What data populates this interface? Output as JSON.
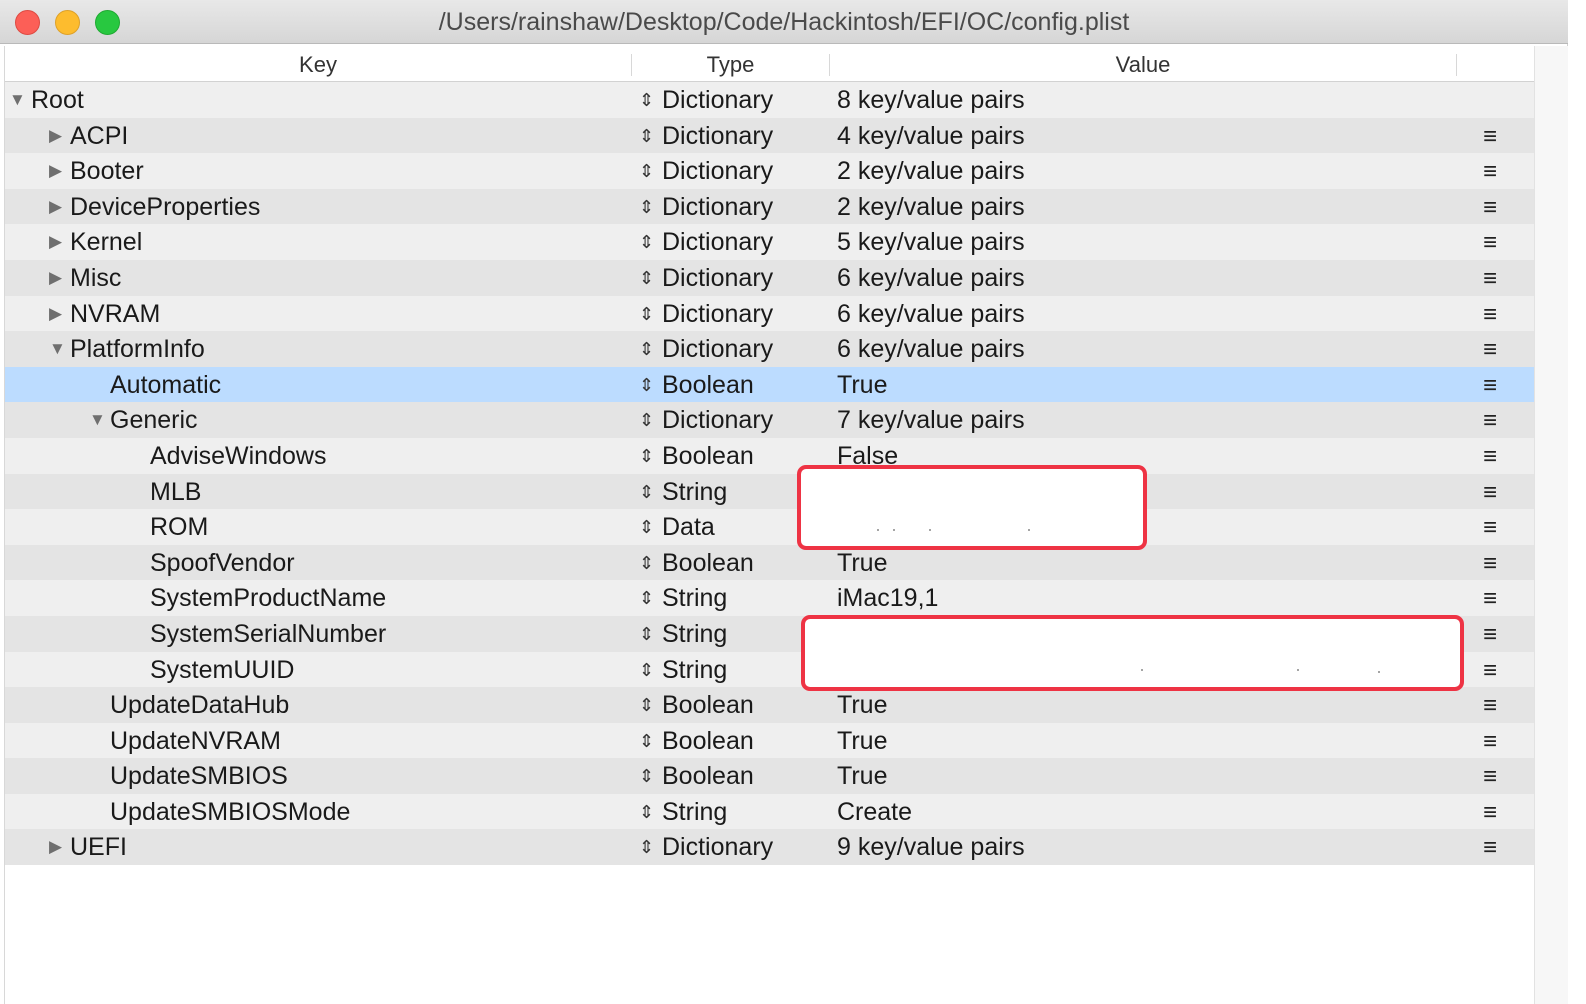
{
  "window": {
    "title": "/Users/rainshaw/Desktop/Code/Hackintosh/EFI/OC/config.plist"
  },
  "columns": {
    "key": "Key",
    "type": "Type",
    "value": "Value"
  },
  "icons": {
    "expanded": "disclosure-triangle-down",
    "collapsed": "disclosure-triangle-right",
    "type_stepper": "up-down-arrows",
    "row_menu": "hamburger-menu"
  },
  "colors": {
    "selection": "#bcdcff",
    "redaction_border": "#ee3344"
  },
  "rows": [
    {
      "key": "Root",
      "type": "Dictionary",
      "value": "8 key/value pairs",
      "level": 0,
      "disclosure": "expanded",
      "menu": false
    },
    {
      "key": "ACPI",
      "type": "Dictionary",
      "value": "4 key/value pairs",
      "level": 1,
      "disclosure": "collapsed",
      "menu": true
    },
    {
      "key": "Booter",
      "type": "Dictionary",
      "value": "2 key/value pairs",
      "level": 1,
      "disclosure": "collapsed",
      "menu": true
    },
    {
      "key": "DeviceProperties",
      "type": "Dictionary",
      "value": "2 key/value pairs",
      "level": 1,
      "disclosure": "collapsed",
      "menu": true
    },
    {
      "key": "Kernel",
      "type": "Dictionary",
      "value": "5 key/value pairs",
      "level": 1,
      "disclosure": "collapsed",
      "menu": true
    },
    {
      "key": "Misc",
      "type": "Dictionary",
      "value": "6 key/value pairs",
      "level": 1,
      "disclosure": "collapsed",
      "menu": true
    },
    {
      "key": "NVRAM",
      "type": "Dictionary",
      "value": "6 key/value pairs",
      "level": 1,
      "disclosure": "collapsed",
      "menu": true
    },
    {
      "key": "PlatformInfo",
      "type": "Dictionary",
      "value": "6 key/value pairs",
      "level": 1,
      "disclosure": "expanded",
      "menu": true
    },
    {
      "key": "Automatic",
      "type": "Boolean",
      "value": "True",
      "level": 2,
      "disclosure": "none",
      "menu": true,
      "selected": true
    },
    {
      "key": "Generic",
      "type": "Dictionary",
      "value": "7 key/value pairs",
      "level": 2,
      "disclosure": "expanded",
      "menu": true
    },
    {
      "key": "AdviseWindows",
      "type": "Boolean",
      "value": "False",
      "level": 3,
      "disclosure": "none",
      "menu": true
    },
    {
      "key": "MLB",
      "type": "String",
      "value": "",
      "level": 3,
      "disclosure": "none",
      "menu": true
    },
    {
      "key": "ROM",
      "type": "Data",
      "value": "",
      "level": 3,
      "disclosure": "none",
      "menu": true
    },
    {
      "key": "SpoofVendor",
      "type": "Boolean",
      "value": "True",
      "level": 3,
      "disclosure": "none",
      "menu": true
    },
    {
      "key": "SystemProductName",
      "type": "String",
      "value": "iMac19,1",
      "level": 3,
      "disclosure": "none",
      "menu": true
    },
    {
      "key": "SystemSerialNumber",
      "type": "String",
      "value": "",
      "level": 3,
      "disclosure": "none",
      "menu": true
    },
    {
      "key": "SystemUUID",
      "type": "String",
      "value": "",
      "level": 3,
      "disclosure": "none",
      "menu": true
    },
    {
      "key": "UpdateDataHub",
      "type": "Boolean",
      "value": "True",
      "level": 2,
      "disclosure": "none",
      "menu": true
    },
    {
      "key": "UpdateNVRAM",
      "type": "Boolean",
      "value": "True",
      "level": 2,
      "disclosure": "none",
      "menu": true
    },
    {
      "key": "UpdateSMBIOS",
      "type": "Boolean",
      "value": "True",
      "level": 2,
      "disclosure": "none",
      "menu": true
    },
    {
      "key": "UpdateSMBIOSMode",
      "type": "String",
      "value": "Create",
      "level": 2,
      "disclosure": "none",
      "menu": true
    },
    {
      "key": "UEFI",
      "type": "Dictionary",
      "value": "9 key/value pairs",
      "level": 1,
      "disclosure": "collapsed",
      "menu": true
    }
  ]
}
